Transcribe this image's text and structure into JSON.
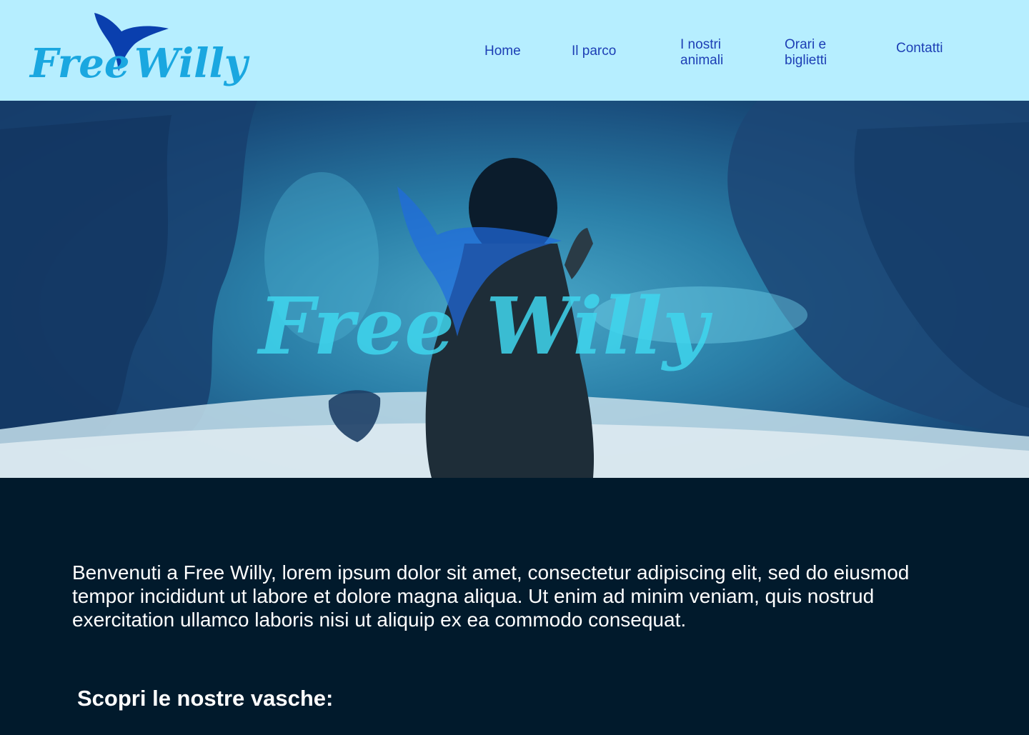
{
  "header": {
    "logo_text_1": "Free",
    "logo_text_2": "Willy",
    "nav": {
      "home": "Home",
      "park": "Il parco",
      "animals_1": "I nostri",
      "animals_2": "animali",
      "hours_1": "Orari e",
      "hours_2": "biglietti",
      "contacts": "Contatti"
    }
  },
  "hero": {
    "watermark_1": "Free",
    "watermark_2": "Willy"
  },
  "main": {
    "intro": "Benvenuti a Free Willy, lorem ipsum dolor sit amet, consectetur adipiscing elit, sed do eiusmod tempor incididunt ut labore et dolore magna aliqua. Ut enim ad minim veniam, quis nostrud exercitation ullamco laboris nisi ut aliquip ex ea commodo consequat.",
    "subheading": "Scopri le nostre vasche:"
  },
  "colors": {
    "header_bg": "#b6eeff",
    "nav_text": "#1d3fb5",
    "logo_light": "#1aa7e0",
    "logo_dark": "#0a3fae",
    "content_bg": "#011a2c"
  },
  "icons": {
    "logo_tail": "whale-tail-icon"
  }
}
